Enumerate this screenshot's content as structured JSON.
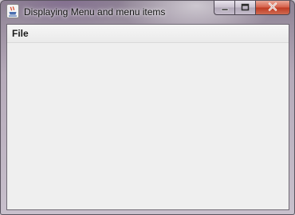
{
  "window": {
    "title": "Displaying Menu and menu items"
  },
  "menubar": {
    "menus": [
      {
        "label": "File"
      }
    ]
  },
  "controls": {
    "minimize_icon": "minimize-icon",
    "maximize_icon": "maximize-icon",
    "close_icon": "close-icon"
  },
  "colors": {
    "client_background": "#efefef",
    "close_button": "#c9482f"
  }
}
